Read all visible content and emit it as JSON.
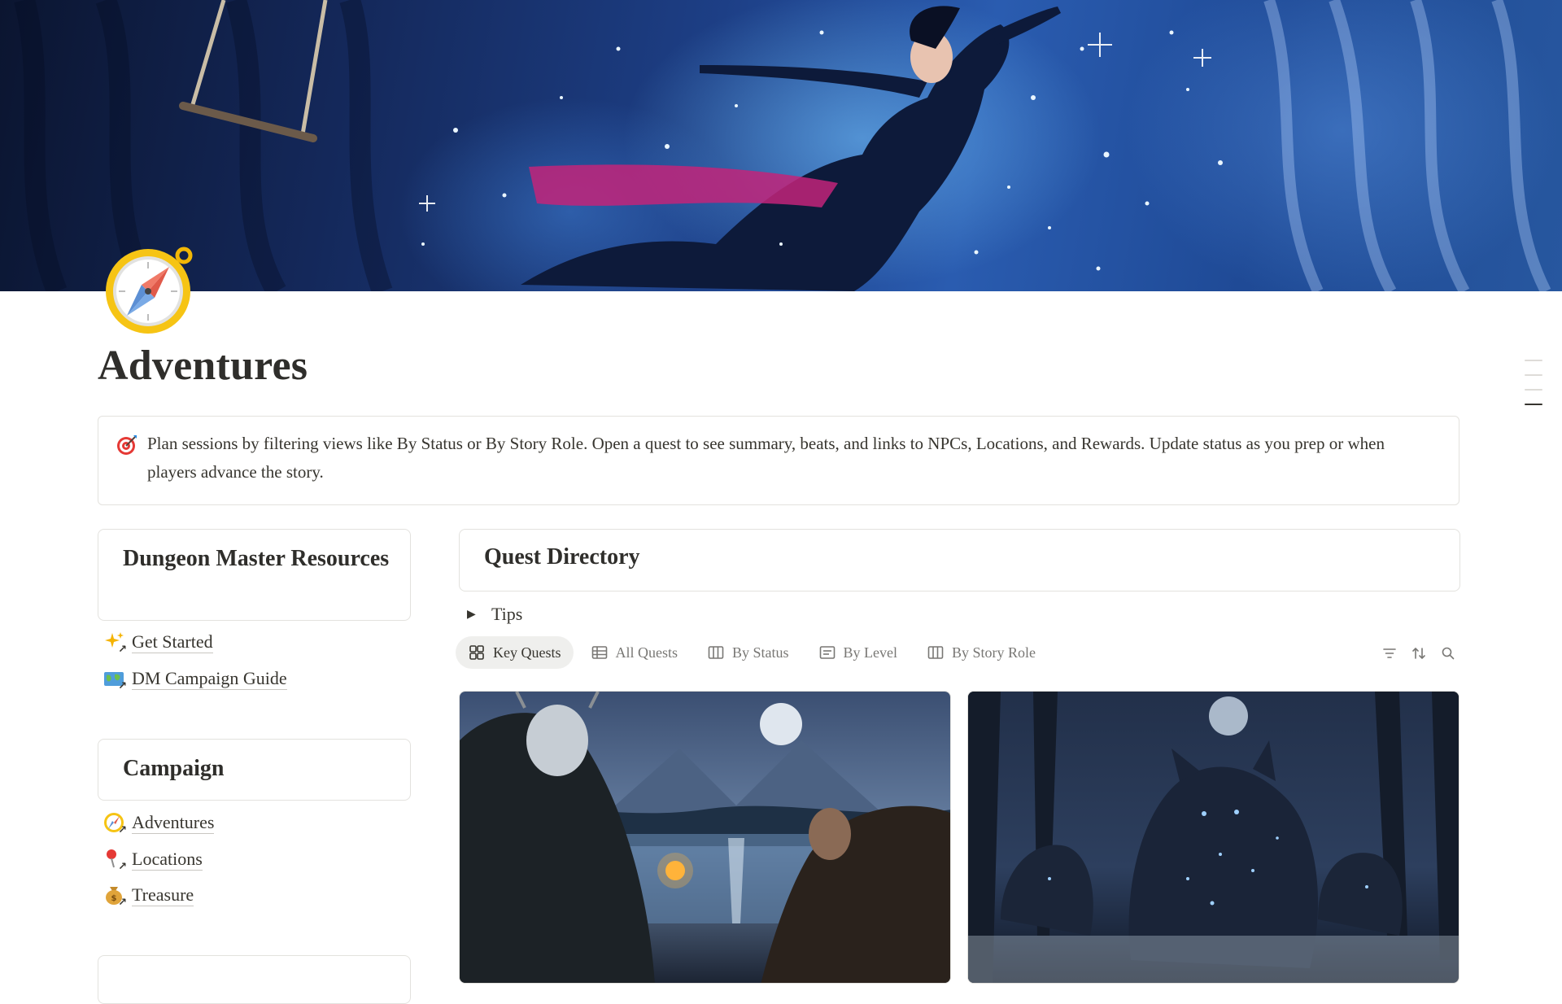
{
  "page": {
    "title": "Adventures",
    "icon": "compass-icon",
    "cover": "cosmic-trapeze-artist-cover"
  },
  "callout": {
    "icon": "target-icon",
    "text": "Plan sessions by filtering views like By Status or By Story Role. Open a quest to see summary, beats, and links to NPCs, Locations, and Rewards. Update status as you prep or when players advance the story."
  },
  "sidebar": {
    "sections": [
      {
        "title": "Dungeon Master Resources",
        "links": [
          {
            "icon": "sparkles-icon",
            "label": "Get Started"
          },
          {
            "icon": "world-map-icon",
            "label": "DM Campaign Guide"
          }
        ]
      },
      {
        "title": "Campaign",
        "links": [
          {
            "icon": "compass-icon",
            "label": "Adventures"
          },
          {
            "icon": "pushpin-icon",
            "label": "Locations"
          },
          {
            "icon": "money-bag-icon",
            "label": "Treasure"
          }
        ]
      }
    ]
  },
  "main": {
    "heading": "Quest Directory",
    "toggle_label": "Tips",
    "views": [
      {
        "icon": "gallery-icon",
        "label": "Key Quests",
        "active": true
      },
      {
        "icon": "table-icon",
        "label": "All Quests",
        "active": false
      },
      {
        "icon": "board-icon",
        "label": "By Status",
        "active": false
      },
      {
        "icon": "list-icon",
        "label": "By Level",
        "active": false
      },
      {
        "icon": "board-icon",
        "label": "By Story Role",
        "active": false
      }
    ],
    "tools": [
      "filter-icon",
      "sort-icon",
      "search-icon"
    ],
    "gallery": [
      {
        "image": "moonlit-lake-pact-artwork"
      },
      {
        "image": "starry-wolves-artwork"
      }
    ]
  },
  "colors": {
    "text": "#37352f",
    "muted": "#787774",
    "border": "#e3e2de",
    "active_tab": "#efefed"
  }
}
